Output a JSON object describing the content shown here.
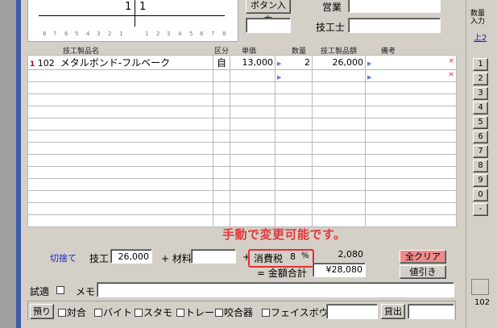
{
  "header": {
    "button_input_label": "ボタン入力",
    "sales_label": "営業",
    "technician_label": "技工士"
  },
  "chart": {
    "top_left": "1",
    "top_right": "1",
    "ticks_left": [
      "8",
      "7",
      "6",
      "5",
      "4",
      "3",
      "2",
      "1"
    ],
    "ticks_right": [
      "1",
      "2",
      "3",
      "4",
      "5",
      "6",
      "7",
      "8"
    ]
  },
  "table": {
    "columns": [
      "技工製品名",
      "区分",
      "単価",
      "数量",
      "技工製品額",
      "備考"
    ],
    "rows": [
      {
        "idx": "1",
        "code": "102",
        "name": "メタルボンド-フルベーク",
        "kubun": "自",
        "unit_price": "13,000",
        "qty": "2",
        "amount": "26,000",
        "note": ""
      }
    ]
  },
  "right_panel": {
    "qty_label": "数量入力",
    "up_link": "上2",
    "numbers": [
      "1",
      "2",
      "3",
      "4",
      "5",
      "6",
      "7",
      "8",
      "9",
      "0",
      "-"
    ],
    "bottom_value": "102"
  },
  "footer": {
    "rounding_link": "切捨て",
    "labor_label": "技工",
    "labor_value": "26,000",
    "plus_material": "+ 材料",
    "material_value": "",
    "plus_tax": "+",
    "tax_label": "消費税",
    "tax_rate": "8",
    "tax_percent": "%",
    "tax_value": "2,080",
    "eq_total": "= 金額合計",
    "total_value": "¥28,080",
    "clear_all": "全クリア",
    "discount": "値引き",
    "annotation": "手動で変更可能です。",
    "trial_label": "試適",
    "memo_label": "メモ",
    "memo_value": ""
  },
  "options": {
    "kari_button": "預り",
    "items": [
      "対合",
      "バイト",
      "スタモ",
      "トレー",
      "咬合器",
      "フェイスボウ"
    ],
    "extra_field": "",
    "lend_label": "貸出"
  },
  "colors": {
    "annotation": "#e2393a",
    "clear_button": "#f08b8b",
    "link": "#1020c0"
  }
}
